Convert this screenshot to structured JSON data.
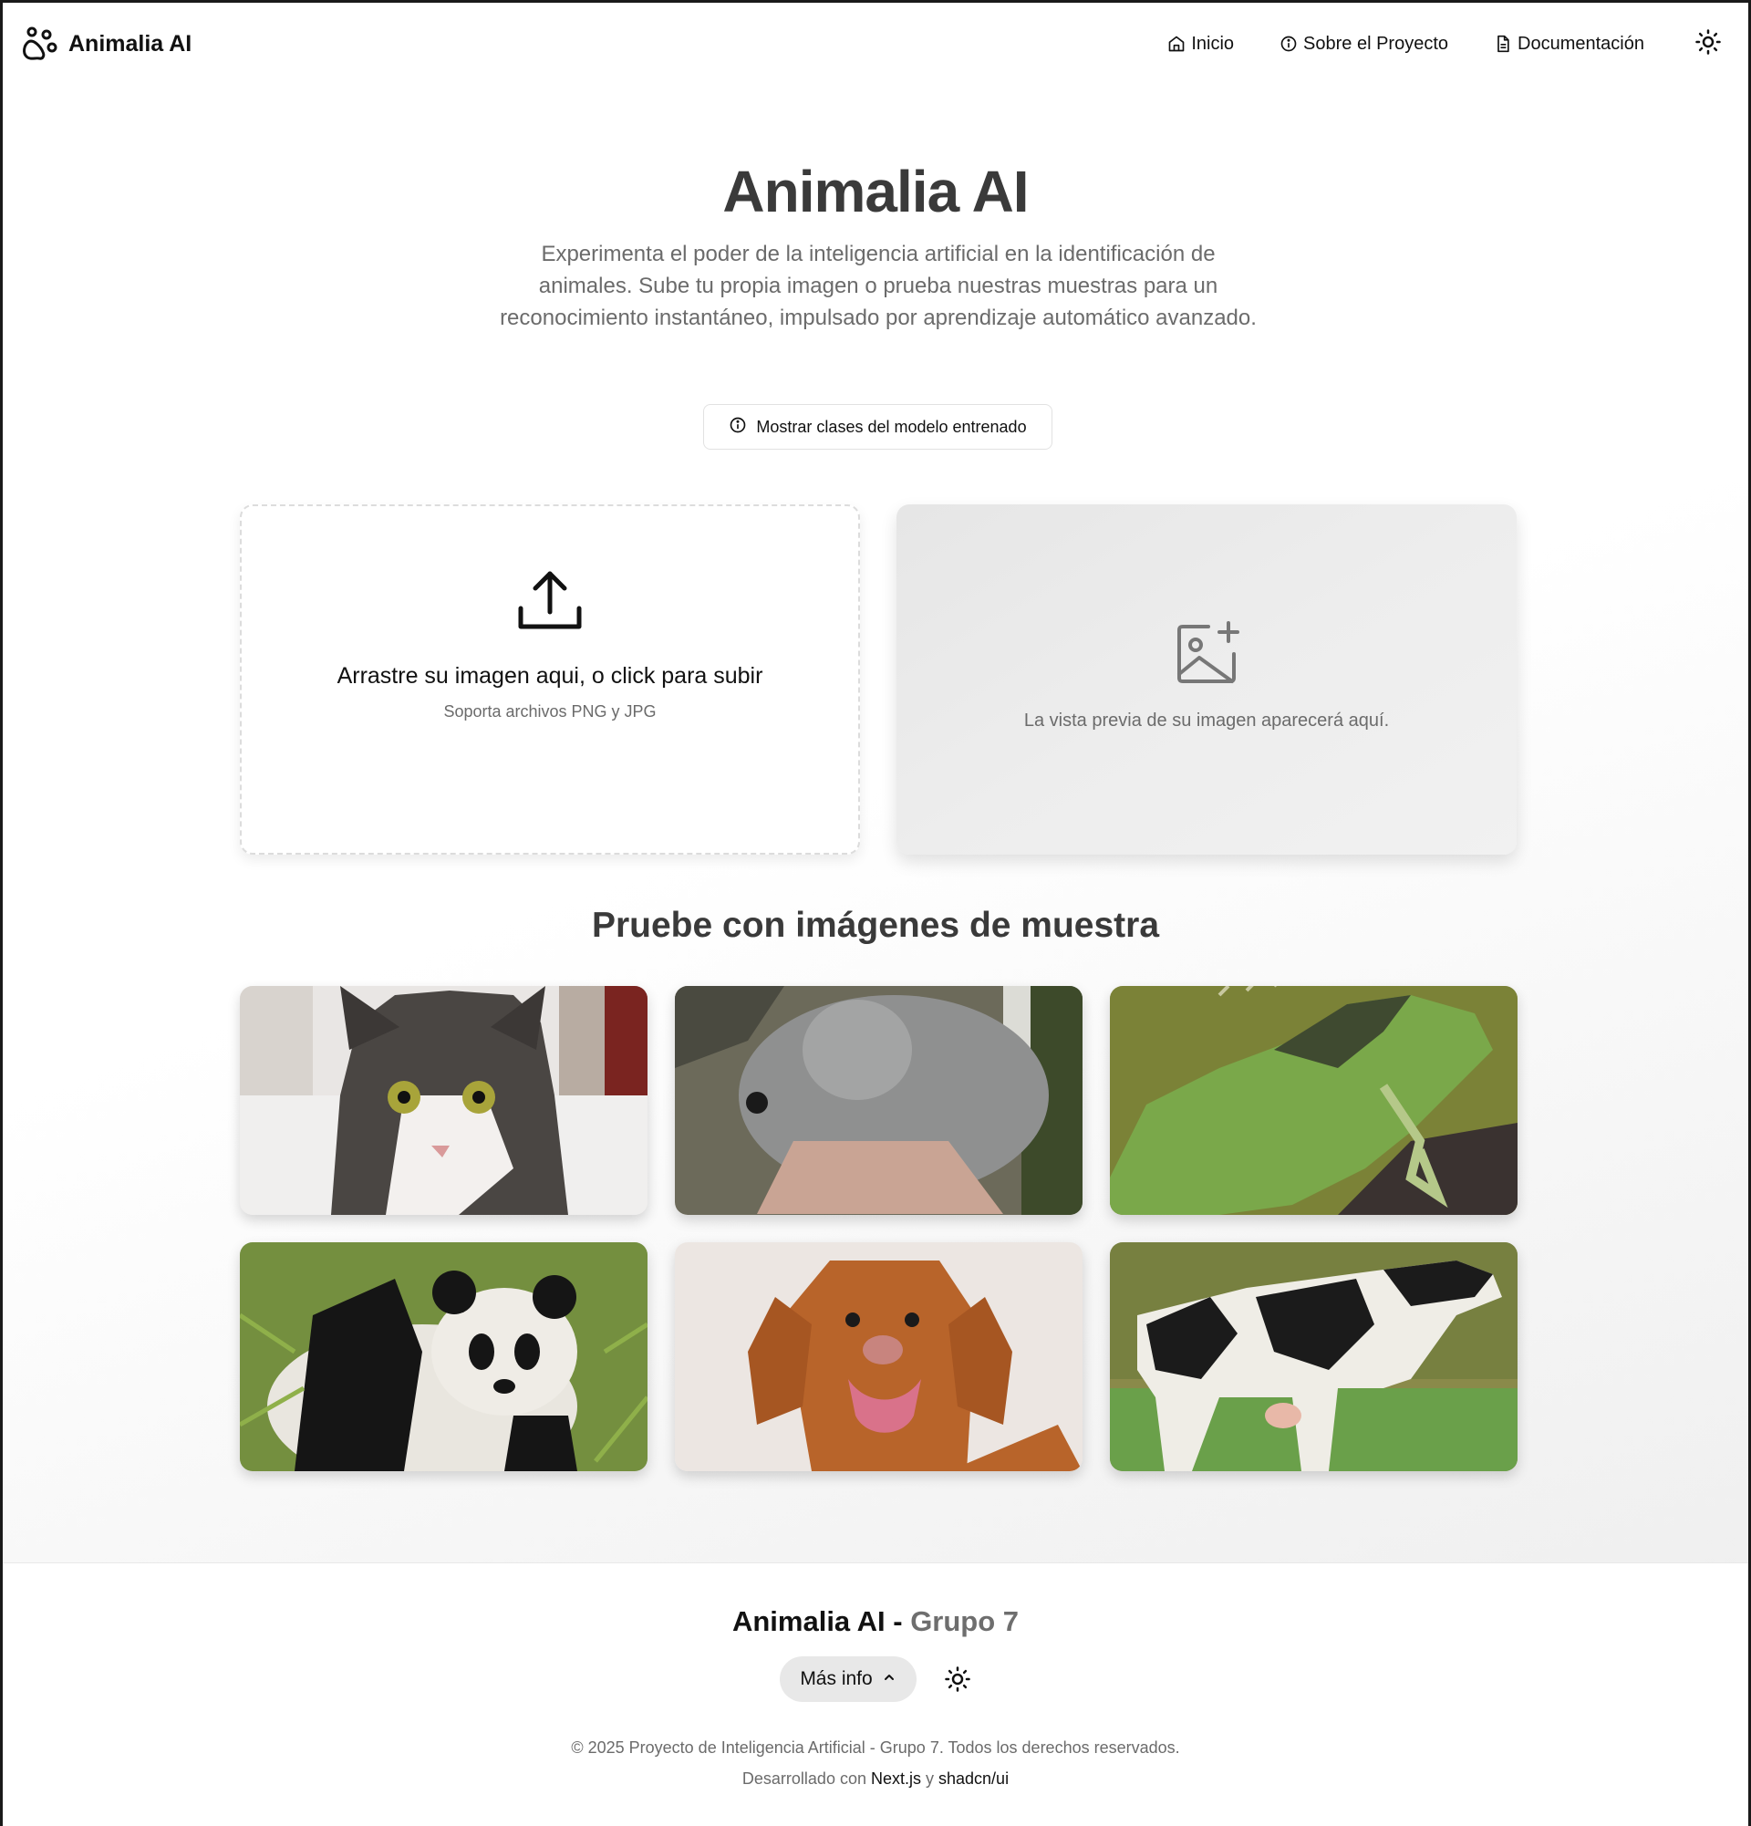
{
  "nav": {
    "brand": "Animalia AI",
    "links": [
      {
        "label": "Inicio",
        "icon": "home-icon"
      },
      {
        "label": "Sobre el Proyecto",
        "icon": "info-icon"
      },
      {
        "label": "Documentación",
        "icon": "document-icon"
      }
    ],
    "theme_icon": "sun-icon"
  },
  "hero": {
    "title": "Animalia AI",
    "description": "Experimenta el poder de la inteligencia artificial en la identificación de animales. Sube tu propia imagen o prueba nuestras muestras para un reconocimiento instantáneo, impulsado por aprendizaje automático avanzado.",
    "classes_button": "Mostrar clases del modelo entrenado"
  },
  "upload": {
    "title": "Arrastre su imagen aqui, o click para subir",
    "subtitle": "Soporta archivos PNG y JPG",
    "icon": "upload-icon"
  },
  "preview": {
    "text": "La vista previa de su imagen aparecerá aquí.",
    "icon": "image-plus-icon"
  },
  "samples": {
    "title": "Pruebe con imágenes de muestra",
    "images": [
      "cat",
      "chinchilla",
      "iguana",
      "panda",
      "dog",
      "cow"
    ]
  },
  "footer": {
    "title_main": "Animalia AI - ",
    "title_group": "Grupo 7",
    "more_button": "Más info",
    "copyright": "© 2025 Proyecto de Inteligencia Artificial - Grupo 7. Todos los derechos reservados.",
    "dev_prefix": "Desarrollado con ",
    "dev_link1": "Next.js",
    "dev_mid": " y ",
    "dev_link2": "shadcn/ui"
  },
  "colors": {
    "heading": "#3a3a3a",
    "muted": "#6b6b6b",
    "preview_bg": "#ececec",
    "pill_bg": "#e8e8e8"
  }
}
